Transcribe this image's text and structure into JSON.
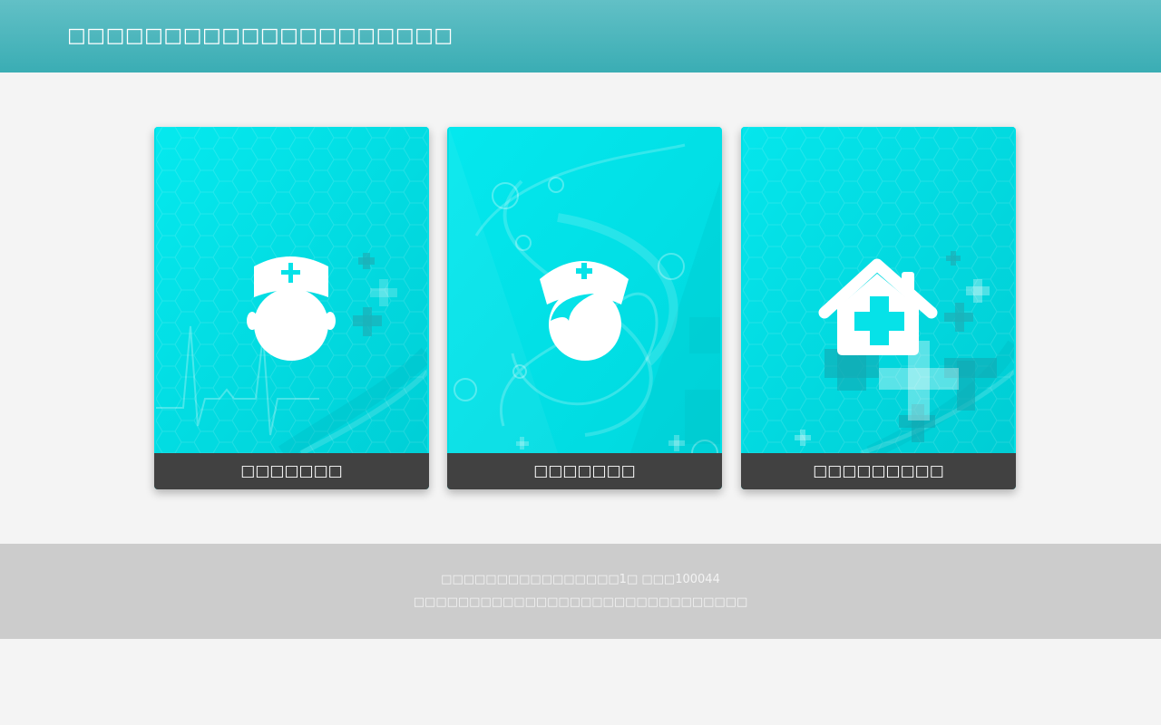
{
  "header": {
    "title": "□□□□□□□□□□□□□□□□□□□□"
  },
  "cards": [
    {
      "label": "□□□□□□□",
      "icon": "doctor-icon"
    },
    {
      "label": "□□□□□□□",
      "icon": "nurse-icon"
    },
    {
      "label": "□□□□□□□□□",
      "icon": "hospital-icon"
    }
  ],
  "footer": {
    "line1": "□□□□□□□□□□□□□□□□1□ □□□100044",
    "line2": "□□□□□□□□□□□□□□□□□□□□□□□□□□□□□□"
  },
  "colors": {
    "header_gradient_top": "#62c0c6",
    "header_gradient_bottom": "#3aadb4",
    "card_cyan": "#03dfe6",
    "card_label_bg": "#414141",
    "footer_bg": "#cccccc",
    "page_bg": "#f4f4f4"
  }
}
